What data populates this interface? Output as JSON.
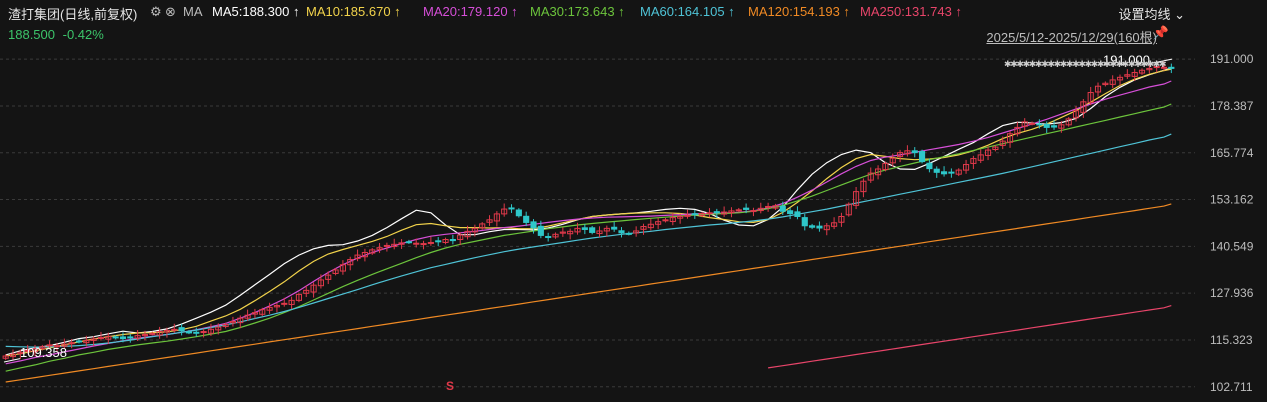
{
  "header": {
    "title": "渣打集团(日线,前复权)",
    "ma_label": "MA",
    "ma": [
      {
        "label": "MA5:188.300",
        "color": "#ffffff"
      },
      {
        "label": "MA10:185.670",
        "color": "#f2d34b"
      },
      {
        "label": "MA20:179.120",
        "color": "#d64fd8"
      },
      {
        "label": "MA30:173.643",
        "color": "#6cc43c"
      },
      {
        "label": "MA60:164.105",
        "color": "#4fc3d6"
      },
      {
        "label": "MA120:154.193",
        "color": "#f08a24"
      },
      {
        "label": "MA250:131.743",
        "color": "#e8456a"
      }
    ],
    "arrow": "↑",
    "settings": "设置均线",
    "price": "188.500",
    "change": "-0.42%",
    "date_range": "2025/5/12-2025/12/29(160根)"
  },
  "chart_data": {
    "type": "candlestick",
    "y_ticks": [
      "191.000",
      "178.387",
      "165.774",
      "153.162",
      "140.549",
      "127.936",
      "115.323",
      "102.711"
    ],
    "ylim": [
      100.5,
      194
    ],
    "n_bars": 160,
    "closes": [
      111,
      111.5,
      112,
      112.5,
      113,
      113.5,
      114,
      113.8,
      114.2,
      114.6,
      114.9,
      115.2,
      115.6,
      116,
      116.3,
      116,
      115.7,
      116.1,
      116.5,
      116.8,
      117.1,
      117.6,
      117.9,
      118.2,
      117.8,
      117.4,
      117.2,
      117.6,
      118.2,
      118.8,
      119.5,
      120.3,
      121.2,
      122,
      122.7,
      123.5,
      124.1,
      124.6,
      125.2,
      126,
      127.6,
      128.7,
      130.1,
      131.5,
      132.8,
      134.2,
      135.6,
      137,
      138.2,
      138.9,
      139.6,
      140.2,
      140.8,
      141.1,
      141.5,
      141.7,
      141.4,
      141.3,
      141.6,
      141.9,
      142.4,
      142.1,
      143.6,
      144.6,
      145.4,
      146.6,
      147.7,
      149.3,
      150.6,
      150.8,
      148.8,
      147,
      145.5,
      143.5,
      143.1,
      143.8,
      144.4,
      144.6,
      145.4,
      145.1,
      144.3,
      144.7,
      145.4,
      145.2,
      144.2,
      144,
      144.7,
      145.9,
      146.5,
      147.2,
      147.7,
      148.3,
      148.6,
      148.9,
      149.2,
      149.4,
      149.6,
      149.7,
      149.8,
      150.1,
      150.4,
      150.5,
      150.2,
      150.8,
      151.3,
      151.5,
      150,
      149.4,
      148.6,
      146.1,
      145.7,
      145.5,
      146.1,
      146.9,
      148.6,
      151.9,
      155.3,
      158.1,
      160.3,
      161.4,
      162.9,
      164.3,
      165.8,
      166.3,
      165.8,
      163.4,
      161.5,
      160.5,
      160.1,
      160.3,
      161.1,
      162.6,
      164.2,
      165.2,
      166.5,
      167.3,
      168.9,
      170.9,
      172.6,
      174.1,
      173.7,
      173.3,
      172.6,
      172.7,
      173.3,
      174.9,
      177.1,
      179.5,
      182,
      183.7,
      184.5,
      185.4,
      186.1,
      186.8,
      187.4,
      188,
      188.5,
      189,
      188.8,
      188.5
    ],
    "hi_label": "191.000",
    "lo_label": "109.358",
    "marker": "S",
    "ma": [
      {
        "name": "MA5",
        "color": "#ffffff",
        "values": [
          111.3,
          112.4,
          113.2,
          113.8,
          114.7,
          115.7,
          116.2,
          117.0,
          117.7,
          117.2,
          117.6,
          118.3,
          119.6,
          121.2,
          122.8,
          124.7,
          127.4,
          130.2,
          133.0,
          135.9,
          138.2,
          139.9,
          140.8,
          141.0,
          142.0,
          143.5,
          145.6,
          148.0,
          150.3,
          149.6,
          146.3,
          143.7,
          143.7,
          144.5,
          145.1,
          145.1,
          145.0,
          145.5,
          146.5,
          147.7,
          148.6,
          149.0,
          149.3,
          149.6,
          150.0,
          150.5,
          150.8,
          150.5,
          149.4,
          147.6,
          146.3,
          146.1,
          147.8,
          151.1,
          155.8,
          160.0,
          163.1,
          165.3,
          166.5,
          165.8,
          163.1,
          161.4,
          161.3,
          162.9,
          164.8,
          166.7,
          168.5,
          170.9,
          173.1,
          174.0,
          173.8,
          173.5,
          173.9,
          175.0,
          177.7,
          180.9,
          183.4,
          185.4,
          186.8,
          188.0,
          188.6
        ]
      },
      {
        "name": "MA10",
        "color": "#f2d34b",
        "values": [
          111.0,
          111.6,
          112.4,
          113.2,
          114.0,
          114.8,
          115.6,
          116.2,
          116.8,
          117.2,
          117.3,
          117.5,
          118.1,
          119.0,
          120.4,
          121.8,
          123.6,
          125.9,
          128.4,
          131.0,
          133.9,
          136.5,
          138.5,
          139.7,
          140.8,
          141.9,
          143.2,
          144.9,
          146.4,
          146.7,
          146.1,
          145.6,
          145.6,
          145.5,
          145.6,
          145.3,
          145.3,
          146.0,
          146.9,
          147.8,
          148.6,
          149.0,
          149.3,
          149.5,
          149.6,
          149.6,
          149.4,
          149.0,
          148.3,
          147.8,
          147.2,
          147.0,
          147.8,
          149.7,
          152.4,
          155.5,
          158.8,
          161.8,
          164.2,
          165.3,
          164.8,
          164.2,
          163.9,
          164.1,
          164.5,
          165.2,
          166.3,
          167.8,
          169.6,
          171.0,
          172.1,
          173.5,
          175.3,
          177.1,
          179.4,
          181.7,
          183.9,
          185.6,
          186.9,
          187.9,
          188.3
        ]
      },
      {
        "name": "MA20",
        "color": "#d64fd8",
        "values": [
          108.9,
          109.7,
          110.6,
          111.3,
          112.1,
          112.9,
          113.7,
          114.4,
          115.1,
          115.8,
          116.3,
          116.8,
          117.4,
          118.1,
          118.9,
          119.8,
          121.2,
          122.7,
          124.5,
          126.4,
          128.6,
          131.1,
          133.5,
          135.6,
          137.4,
          138.9,
          140.1,
          141.3,
          142.4,
          143.3,
          143.8,
          144.2,
          144.6,
          145.1,
          145.6,
          146.0,
          146.5,
          147.0,
          147.5,
          147.9,
          148.2,
          148.4,
          148.5,
          148.6,
          148.7,
          148.9,
          149.1,
          149.3,
          149.4,
          149.5,
          149.7,
          150.1,
          150.9,
          152.1,
          153.8,
          155.7,
          157.9,
          160.1,
          162.1,
          163.7,
          164.6,
          165.2,
          165.9,
          166.6,
          167.3,
          168.0,
          168.9,
          169.9,
          171.1,
          172.3,
          173.5,
          174.8,
          176.2,
          177.6,
          178.9,
          180.2,
          181.3,
          182.4,
          183.5,
          184.3,
          185.1
        ]
      },
      {
        "name": "MA30",
        "color": "#6cc43c",
        "values": [
          106.9,
          107.8,
          108.6,
          109.6,
          110.4,
          111.3,
          112.0,
          112.8,
          113.4,
          114.0,
          114.5,
          115.0,
          115.6,
          116.2,
          116.9,
          117.6,
          118.7,
          119.9,
          121.2,
          122.7,
          124.3,
          126.1,
          127.9,
          129.7,
          131.4,
          133.0,
          134.5,
          136.0,
          137.5,
          138.9,
          140.1,
          141.1,
          141.9,
          142.7,
          143.5,
          144.1,
          144.7,
          145.3,
          145.8,
          146.3,
          146.7,
          147.1,
          147.4,
          147.8,
          148.1,
          148.4,
          148.7,
          149.0,
          149.2,
          149.4,
          149.6,
          150.0,
          150.7,
          151.6,
          152.8,
          154.1,
          155.6,
          157.1,
          158.6,
          160.0,
          161.1,
          162.1,
          163.0,
          163.9,
          164.7,
          165.5,
          166.4,
          167.3,
          168.2,
          169.1,
          170.0,
          170.9,
          171.8,
          172.7,
          173.6,
          174.5,
          175.4,
          176.3,
          177.2,
          178.1,
          178.9
        ]
      },
      {
        "name": "MA60",
        "color": "#4fc3d6",
        "values": [
          113.6,
          113.5,
          113.4,
          113.5,
          113.6,
          113.8,
          114.1,
          114.5,
          115.0,
          115.6,
          116.2,
          116.8,
          117.4,
          118.0,
          118.7,
          119.4,
          120.2,
          121.1,
          122.0,
          123.0,
          124.1,
          125.3,
          126.5,
          127.7,
          128.9,
          130.2,
          131.4,
          132.6,
          133.7,
          134.8,
          135.7,
          136.6,
          137.5,
          138.3,
          139.1,
          139.8,
          140.4,
          141.0,
          141.6,
          142.2,
          142.8,
          143.3,
          143.8,
          144.2,
          144.6,
          145.1,
          145.5,
          145.9,
          146.3,
          146.6,
          147.0,
          147.4,
          147.9,
          148.5,
          149.2,
          149.9,
          150.6,
          151.4,
          152.2,
          153.0,
          153.8,
          154.6,
          155.4,
          156.2,
          157.0,
          157.8,
          158.6,
          159.4,
          160.2,
          161.1,
          162.0,
          162.9,
          163.8,
          164.7,
          165.6,
          166.5,
          167.4,
          168.3,
          169.2,
          170.0,
          170.8
        ]
      },
      {
        "name": "MA120",
        "color": "#f08a24",
        "values": [
          104.0,
          104.6,
          105.2,
          105.8,
          106.4,
          107.0,
          107.6,
          108.2,
          108.8,
          109.4,
          110.0,
          110.6,
          111.2,
          111.8,
          112.4,
          113.0,
          113.6,
          114.2,
          114.8,
          115.4,
          116.0,
          116.6,
          117.2,
          117.8,
          118.4,
          119.0,
          119.6,
          120.2,
          120.8,
          121.4,
          122.0,
          122.6,
          123.2,
          123.8,
          124.4,
          125.0,
          125.6,
          126.2,
          126.8,
          127.4,
          128.0,
          128.6,
          129.2,
          129.8,
          130.4,
          131.0,
          131.6,
          132.2,
          132.8,
          133.4,
          134.0,
          134.6,
          135.2,
          135.8,
          136.4,
          137.0,
          137.6,
          138.2,
          138.8,
          139.4,
          140.0,
          140.6,
          141.2,
          141.8,
          142.4,
          143.0,
          143.6,
          144.2,
          144.8,
          145.4,
          146.0,
          146.6,
          147.2,
          147.8,
          148.4,
          149.0,
          149.6,
          150.2,
          150.8,
          151.4,
          152.0
        ]
      },
      {
        "name": "MA250",
        "color": "#e8456a",
        "values": [
          null,
          null,
          null,
          null,
          null,
          null,
          null,
          null,
          null,
          null,
          null,
          null,
          null,
          null,
          null,
          null,
          null,
          null,
          null,
          null,
          null,
          null,
          null,
          null,
          null,
          null,
          null,
          null,
          null,
          null,
          null,
          null,
          null,
          null,
          null,
          null,
          null,
          null,
          null,
          null,
          null,
          null,
          null,
          null,
          null,
          null,
          null,
          null,
          null,
          null,
          null,
          null,
          107.8,
          108.4,
          109.0,
          109.6,
          110.2,
          110.8,
          111.4,
          112.0,
          112.6,
          113.2,
          113.8,
          114.4,
          115.0,
          115.6,
          116.2,
          116.8,
          117.4,
          118.0,
          118.6,
          119.2,
          119.8,
          120.4,
          121.0,
          121.6,
          122.2,
          122.8,
          123.4,
          124.0,
          124.6
        ]
      }
    ]
  }
}
